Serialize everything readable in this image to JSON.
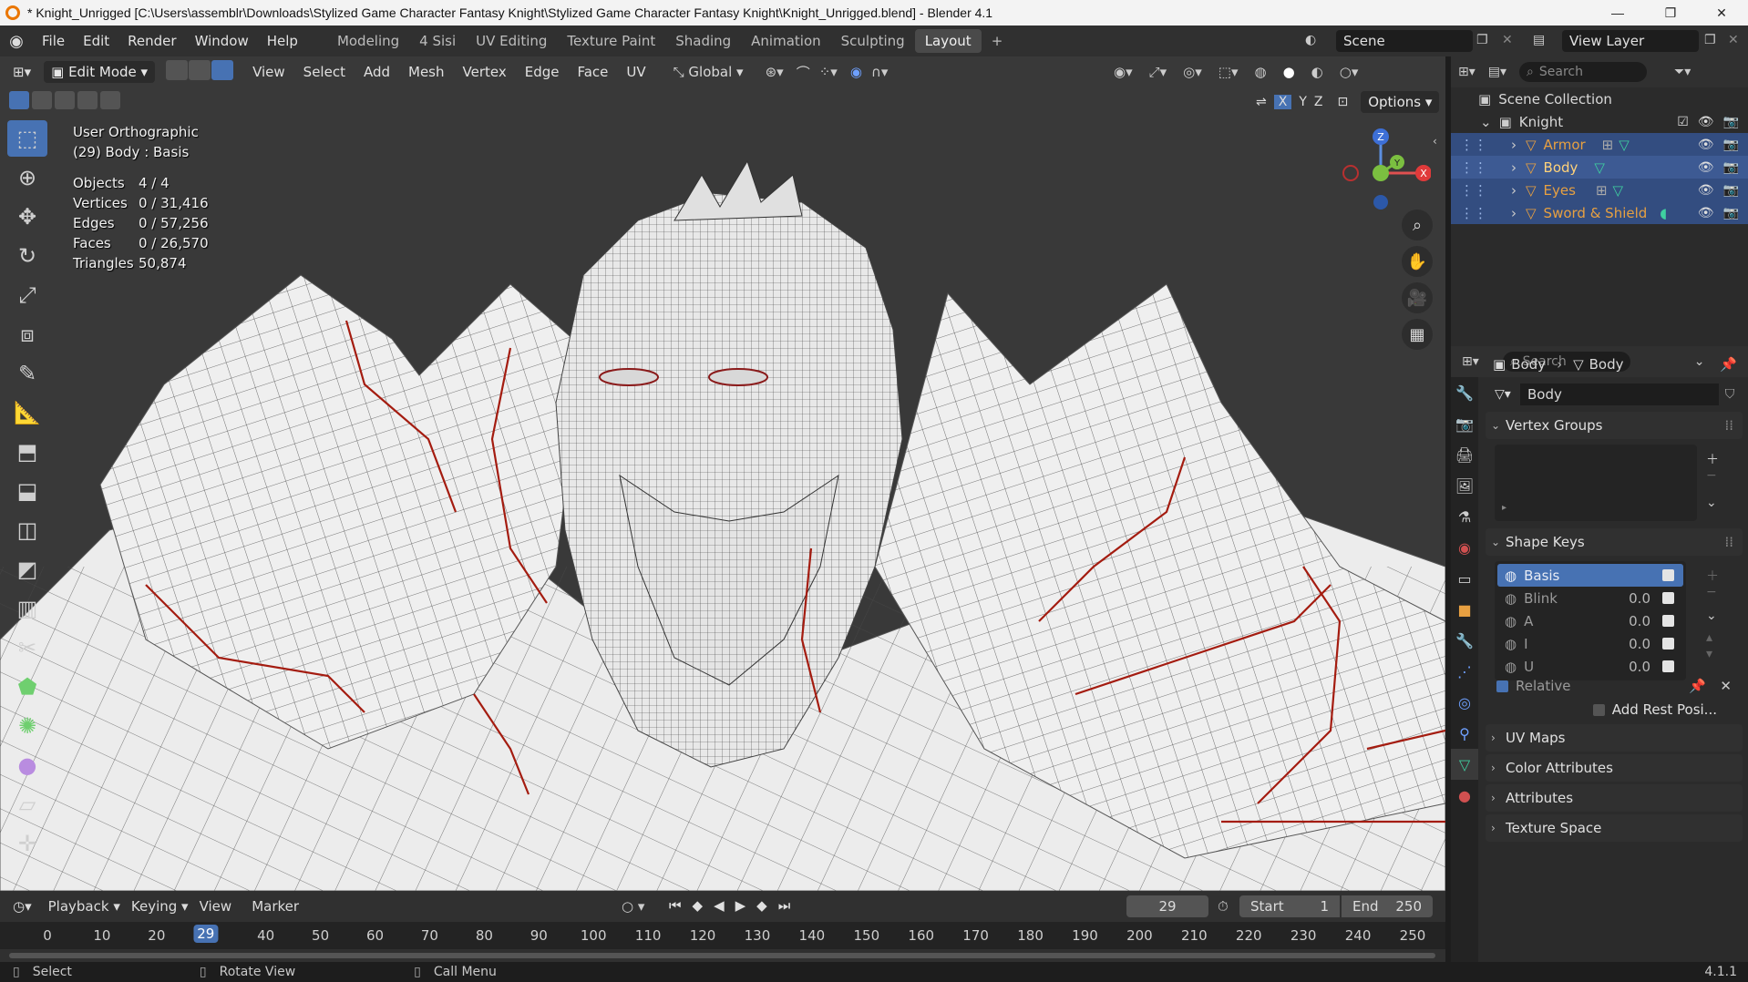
{
  "window": {
    "title": "* Knight_Unrigged [C:\\Users\\assemblr\\Downloads\\Stylized Game Character Fantasy Knight\\Stylized Game Character Fantasy Knight\\Knight_Unrigged.blend] - Blender 4.1",
    "minimize": "—",
    "maximize": "❐",
    "close": "✕"
  },
  "menu": {
    "items": [
      "File",
      "Edit",
      "Render",
      "Window",
      "Help"
    ],
    "workspaces": [
      "Modeling",
      "4 Sisi",
      "UV Editing",
      "Texture Paint",
      "Shading",
      "Animation",
      "Sculpting",
      "Layout"
    ],
    "active_workspace": "Layout",
    "add_workspace": "+",
    "scene": "Scene",
    "view_layer": "View Layer"
  },
  "viewport_header": {
    "mode": "Edit Mode",
    "menus": [
      "View",
      "Select",
      "Add",
      "Mesh",
      "Vertex",
      "Edge",
      "Face",
      "UV"
    ],
    "transform_orientation": "Global",
    "options": "Options",
    "axes": [
      "X",
      "Y",
      "Z"
    ]
  },
  "overlay": {
    "view_name": "User Orthographic",
    "object_info": "(29) Body : Basis",
    "stats": [
      {
        "label": "Objects",
        "value": "4 / 4"
      },
      {
        "label": "Vertices",
        "value": "0 / 31,416"
      },
      {
        "label": "Edges",
        "value": "0 / 57,256"
      },
      {
        "label": "Faces",
        "value": "0 / 26,570"
      },
      {
        "label": "Triangles",
        "value": "50,874"
      }
    ]
  },
  "gizmo": {
    "x": "X",
    "y": "Y",
    "z": "Z"
  },
  "timeline": {
    "menus": [
      "Playback",
      "Keying",
      "View",
      "Marker"
    ],
    "current_frame": "29",
    "start_label": "Start",
    "start": "1",
    "end_label": "End",
    "end": "250",
    "ticks": [
      "0",
      "10",
      "20",
      "29",
      "40",
      "50",
      "60",
      "70",
      "80",
      "90",
      "100",
      "110",
      "120",
      "130",
      "140",
      "150",
      "160",
      "170",
      "180",
      "190",
      "200",
      "210",
      "220",
      "230",
      "240",
      "250"
    ]
  },
  "statusbar": {
    "select": "Select",
    "rotate": "Rotate View",
    "menu": "Call Menu",
    "version": "4.1.1"
  },
  "outliner": {
    "search_placeholder": "Search",
    "collection": "Scene Collection",
    "knight": "Knight",
    "objects": [
      "Armor",
      "Body",
      "Eyes",
      "Sword & Shield"
    ]
  },
  "properties": {
    "search_placeholder": "Search",
    "breadcrumb_object": "Body",
    "breadcrumb_mesh": "Body",
    "mesh_name": "Body",
    "panels": {
      "vertex_groups": "Vertex Groups",
      "shape_keys": "Shape Keys",
      "uv_maps": "UV Maps",
      "color_attributes": "Color Attributes",
      "attributes": "Attributes",
      "texture_space": "Texture Space"
    },
    "shape_keys": [
      {
        "name": "Basis",
        "value": ""
      },
      {
        "name": "Blink",
        "value": "0.0"
      },
      {
        "name": "A",
        "value": "0.0"
      },
      {
        "name": "I",
        "value": "0.0"
      },
      {
        "name": "U",
        "value": "0.0"
      }
    ],
    "relative": "Relative",
    "add_rest": "Add Rest Posi..."
  }
}
